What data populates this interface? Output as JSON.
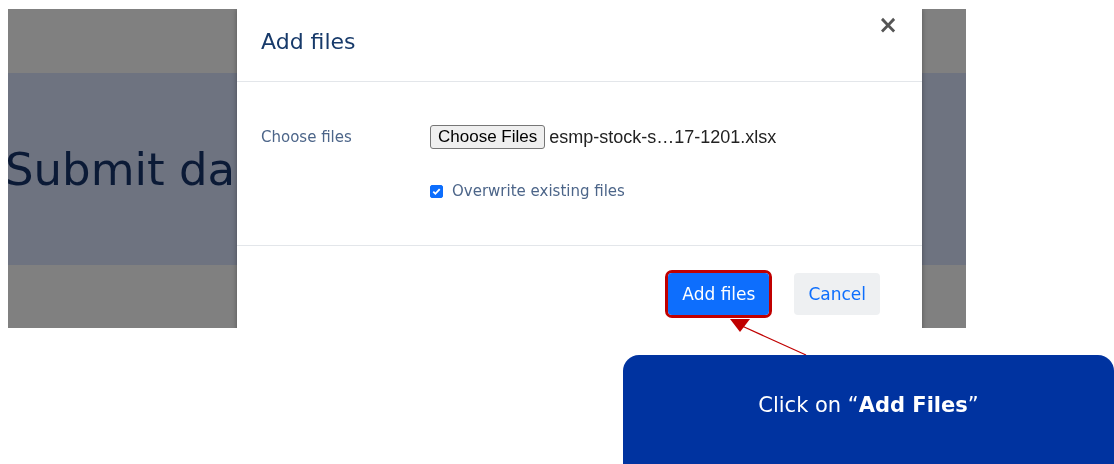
{
  "page": {
    "heading": "Submit da"
  },
  "dialog": {
    "title": "Add files",
    "close": "×",
    "file_field": {
      "label": "Choose files",
      "button": "Choose Files",
      "file_name": "esmp-stock-s…17-1201.xlsx"
    },
    "checkbox": {
      "label": "Overwrite existing files",
      "checked": true
    },
    "buttons": [
      {
        "label": "Add files",
        "kind": "primary",
        "highlighted": true
      },
      {
        "label": "Cancel",
        "kind": "secondary",
        "highlighted": false
      }
    ]
  },
  "callout": {
    "text": "Click on “**Add Files**”"
  }
}
